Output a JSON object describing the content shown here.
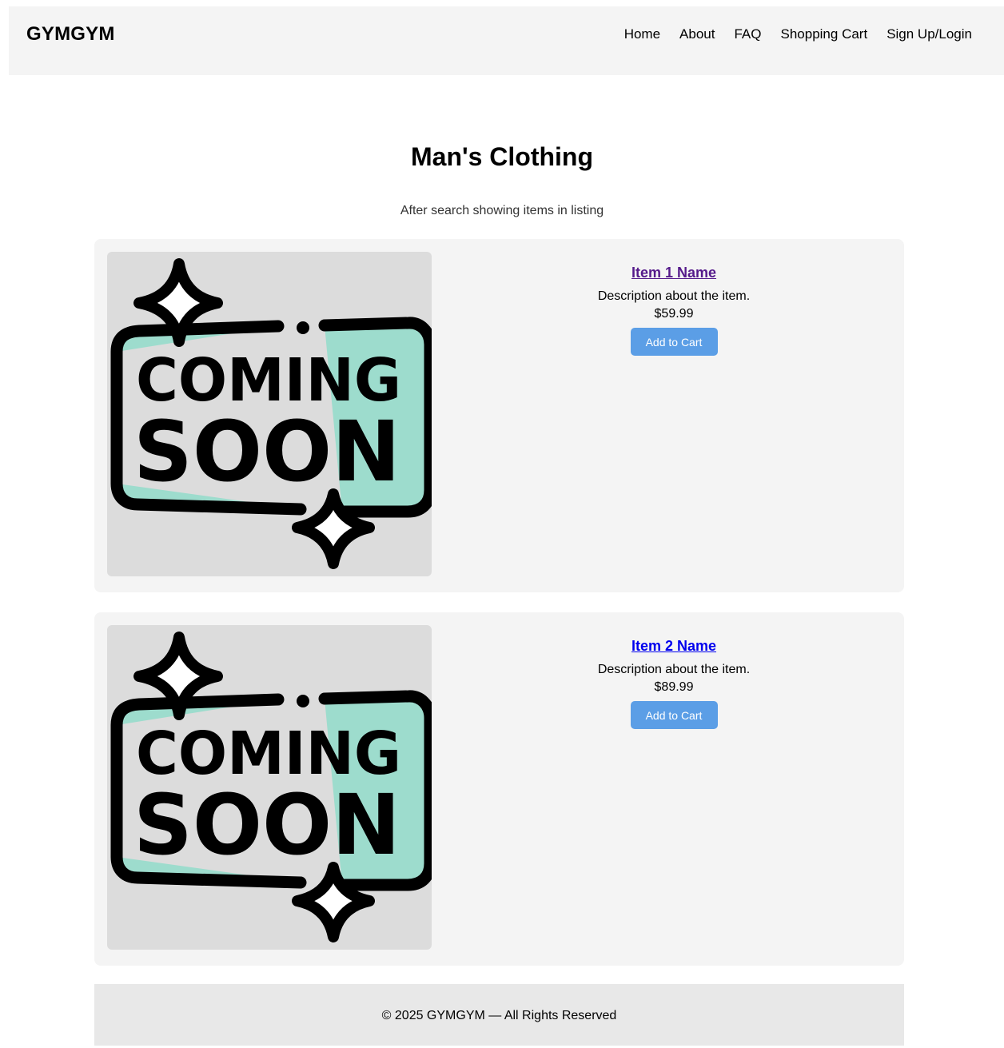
{
  "header": {
    "brand": "GYMGYM",
    "nav": [
      "Home",
      "About",
      "FAQ",
      "Shopping Cart",
      "Sign Up/Login"
    ]
  },
  "page": {
    "title": "Man's Clothing",
    "subtitle": "After search showing items in listing"
  },
  "items": [
    {
      "name": "Item 1 Name",
      "description": "Description about the item.",
      "price": "$59.99",
      "button": "Add to Cart",
      "image_text": [
        "COMING",
        "SOON"
      ]
    },
    {
      "name": "Item 2 Name",
      "description": "Description about the item.",
      "price": "$89.99",
      "button": "Add to Cart",
      "image_text": [
        "COMING",
        "SOON"
      ]
    }
  ],
  "footer": {
    "text": "© 2025 GYMGYM — All Rights Reserved"
  },
  "colors": {
    "button": "#5b9ee6",
    "sign_fill": "#9ddccd",
    "link_visited": "#551a8b",
    "link": "#0000ee"
  }
}
